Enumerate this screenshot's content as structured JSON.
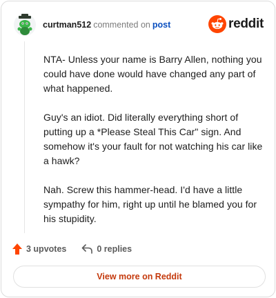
{
  "comment": {
    "author": "curtman512",
    "action_text": "commented on",
    "post_link": "post",
    "paragraphs": [
      "NTA- Unless your name is Barry Allen, nothing you could have done would have changed any part of what happened.",
      "Guy's an idiot. Did literally everything short of putting up a *Please Steal This Car\" sign. And somehow it's your fault for not watching his car like a hawk?",
      "Nah. Screw this hammer-head. I'd have a little sympathy for him, right up until he blamed you for his stupidity."
    ]
  },
  "brand": {
    "logo_text": "reddit",
    "color": "#ff4500"
  },
  "actions": {
    "upvotes": "3 upvotes",
    "replies": "0 replies"
  },
  "cta": {
    "label": "View more on Reddit"
  },
  "icons": {
    "avatar": "snoo-avatar-icon",
    "logo": "reddit-logo-icon",
    "upvote": "upvote-arrow-icon",
    "reply": "reply-arrow-icon"
  }
}
